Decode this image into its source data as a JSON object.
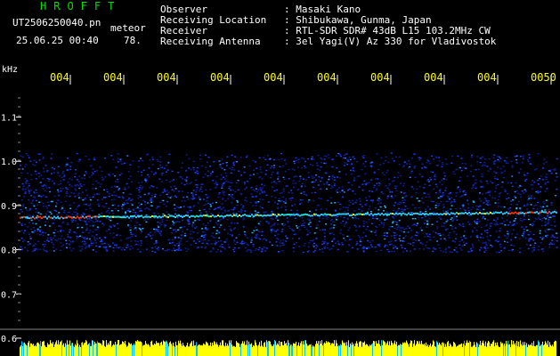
{
  "header": {
    "brand": "HROFFT",
    "file_name": "UT2506250040.pn",
    "label_meteor": "meteor",
    "date_time": "25.06.25 00:40",
    "count": "78."
  },
  "info": [
    {
      "key": "Observer",
      "value": ": Masaki Kano"
    },
    {
      "key": "Receiving Location",
      "value": ": Shibukawa, Gunma, Japan"
    },
    {
      "key": "Receiver",
      "value": ": RTL-SDR SDR# 43dB L15 103.2MHz CW"
    },
    {
      "key": "Receiving Antenna",
      "value": ": 3el Yagi(V) Az 330 for Vladivostok"
    }
  ],
  "time_labels": [
    "004",
    "004",
    "004",
    "004",
    "004",
    "004",
    "004",
    "004",
    "004",
    "0050"
  ],
  "y_axis": {
    "unit": "kHz",
    "ticks": [
      "1.1",
      "1.0",
      "0.9",
      "0.8",
      "0.7",
      "0.6"
    ],
    "values": [
      1.1,
      1.0,
      0.9,
      0.8,
      0.7,
      0.6
    ]
  },
  "colors": {
    "background": "#000000",
    "header_green": "#00e000",
    "text_white": "#ffffff",
    "time_yellow": "#ffff00",
    "noise_blue": "#1a3cff",
    "signal_red": "#ff3300",
    "bar_yellow": "#ffff00",
    "bar_cyan": "#00c8ff"
  }
}
